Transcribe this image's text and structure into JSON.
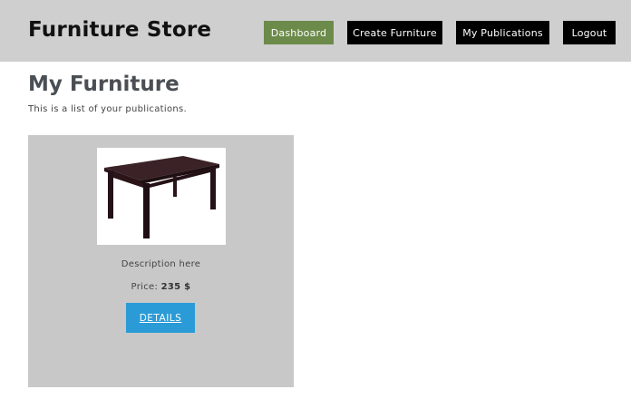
{
  "navbar": {
    "brand": "Furniture Store",
    "links": [
      {
        "label": "Dashboard",
        "active": true
      },
      {
        "label": "Create Furniture",
        "active": false
      },
      {
        "label": "My Publications",
        "active": false
      },
      {
        "label": "Logout",
        "active": false
      }
    ],
    "active_color": "#6c8b4a",
    "link_color": "#000000"
  },
  "main": {
    "title": "My Furniture",
    "subtitle": "This is a list of your publications."
  },
  "items": [
    {
      "image_icon": "table-image",
      "description": "Description here",
      "price_label": "Price:",
      "price_value": "235 $",
      "details_label": "DETAILS"
    }
  ],
  "colors": {
    "navbar_bg": "#cfcfcf",
    "card_bg": "#c8c8c8",
    "details_button": "#2a9bd6"
  }
}
